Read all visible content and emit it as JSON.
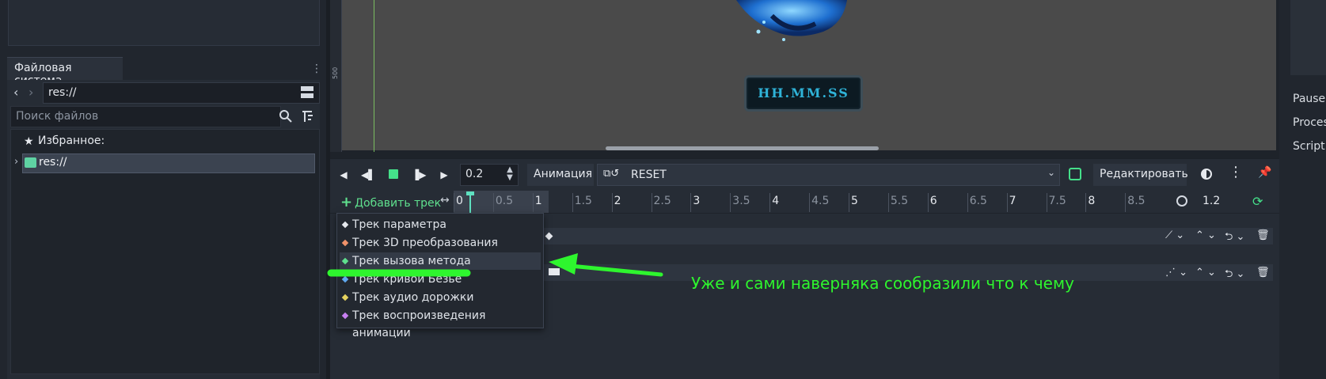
{
  "filesystem": {
    "tab_label": "Файловая система",
    "path_value": "res://",
    "search_placeholder": "Поиск файлов",
    "favorites_label": "Избранное:",
    "root_label": "res://"
  },
  "viewport": {
    "ruler_label": "500",
    "clock_text": "HH.MM.SS"
  },
  "right_dock": {
    "items": [
      "Pause",
      "Proces",
      "Script"
    ]
  },
  "animation": {
    "time_value": "0.2",
    "animation_button": "Анимация",
    "selected_animation": "RESET",
    "edit_button": "Редактировать",
    "add_track_label": "Добавить трек",
    "length_value": "1.2",
    "ticks": [
      "0",
      "0.5",
      "1",
      "1.5",
      "2",
      "2.5",
      "3",
      "3.5",
      "4",
      "4.5",
      "5",
      "5.5",
      "6",
      "6.5",
      "7",
      "7.5",
      "8",
      "8.5"
    ],
    "accent_color": "#45e08a"
  },
  "track_menu": {
    "items": [
      {
        "label": "Трек параметра",
        "color": "#e6e9ee"
      },
      {
        "label": "Трек 3D преобразования",
        "color": "#f0926a"
      },
      {
        "label": "Трек вызова метода",
        "color": "#5fe08e"
      },
      {
        "label": "Трек кривой Безье",
        "color": "#5fa9f0"
      },
      {
        "label": "Трек аудио дорожки",
        "color": "#e6d35f"
      },
      {
        "label": "Трек воспроизведения анимации",
        "color": "#c77ff0"
      }
    ]
  },
  "annotation": {
    "text": "Уже и сами наверняка сообразили что к чему",
    "color": "#2ef52e"
  }
}
